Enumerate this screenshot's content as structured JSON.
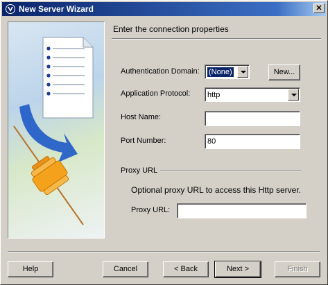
{
  "window": {
    "title": "New Server Wizard",
    "close_glyph": "✕"
  },
  "heading": "Enter the connection properties",
  "form": {
    "auth_domain_label": "Authentication Domain:",
    "auth_domain_value": "(None)",
    "new_button": "New...",
    "protocol_label": "Application Protocol:",
    "protocol_value": "http",
    "host_label": "Host Name:",
    "host_value": "",
    "port_label": "Port Number:",
    "port_value": "80"
  },
  "proxy": {
    "group_title": "Proxy URL",
    "description": "Optional proxy URL to access this Http server.",
    "label": "Proxy URL:",
    "value": ""
  },
  "buttons": {
    "help": "Help",
    "cancel": "Cancel",
    "back": "< Back",
    "next": "Next >",
    "finish": "Finish"
  },
  "colors": {
    "titlebar": "#0a246a",
    "window_bg": "#d4d0c8",
    "accent_orange": "#f0a020"
  }
}
